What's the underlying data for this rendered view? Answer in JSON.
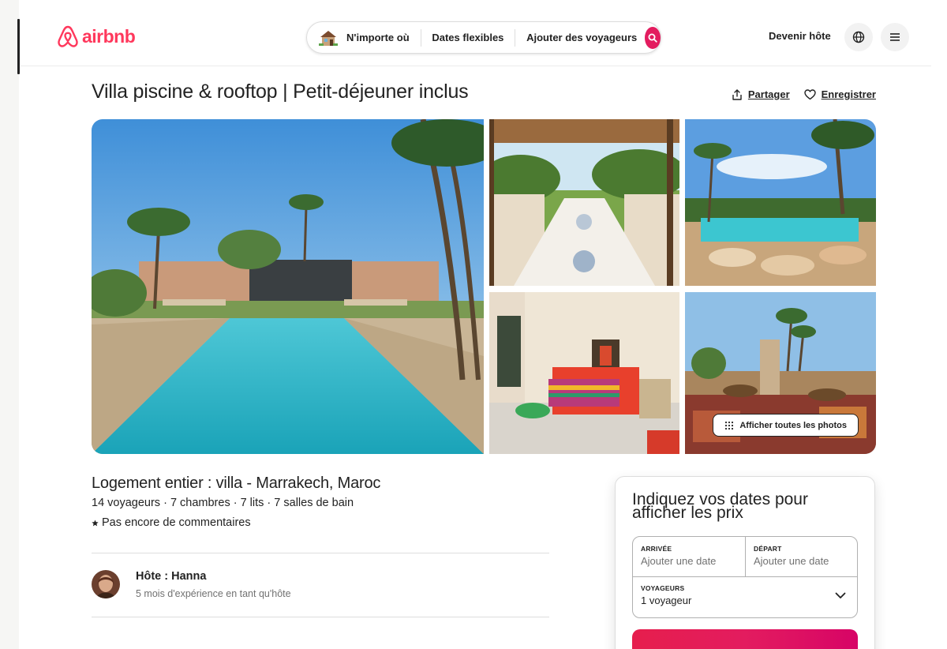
{
  "brand": {
    "logo_text": "airbnb",
    "color": "#FF385C"
  },
  "search": {
    "location": "N'importe où",
    "dates": "Dates flexibles",
    "guests": "Ajouter des voyageurs",
    "button_color": "#E31C5F"
  },
  "header_right": {
    "host_link": "Devenir hôte",
    "language_icon": "globe-icon",
    "menu_icon": "menu-icon"
  },
  "listing": {
    "title": "Villa piscine & rooftop | Petit-déjeuner inclus",
    "share_label": "Partager",
    "save_label": "Enregistrer",
    "show_all_photos": "Afficher toutes les photos",
    "subtitle": "Logement entier : villa - Marrakech, Maroc",
    "stats": "14 voyageurs · 7 chambres · 7 lits · 7 salles de bain",
    "reviews": "Pas encore de commentaires"
  },
  "host": {
    "name": "Hôte : Hanna",
    "experience": "5 mois d'expérience en tant qu'hôte"
  },
  "booking": {
    "title": "Indiquez vos dates pour afficher les prix",
    "checkin_label": "ARRIVÉE",
    "checkin_value": "Ajouter une date",
    "checkout_label": "DÉPART",
    "checkout_value": "Ajouter une date",
    "guests_label": "VOYAGEURS",
    "guests_value": "1 voyageur",
    "cta_color": "#E31C5F"
  }
}
